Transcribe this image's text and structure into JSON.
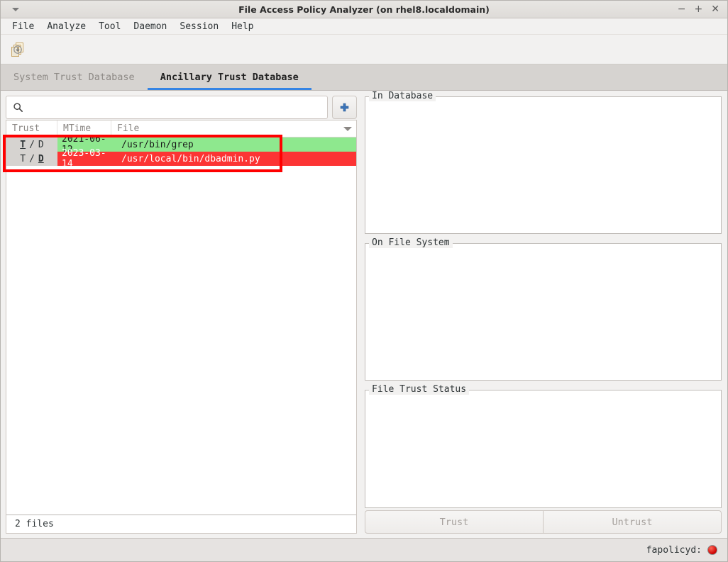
{
  "window": {
    "title": "File Access Policy Analyzer (on rhel8.localdomain)",
    "menu_icon": "window-menu-triangle-icon",
    "minimize_label": "−",
    "maximize_label": "+",
    "close_label": "✕"
  },
  "menubar": {
    "items": [
      {
        "label": "File"
      },
      {
        "label": "Analyze"
      },
      {
        "label": "Tool"
      },
      {
        "label": "Daemon"
      },
      {
        "label": "Session"
      },
      {
        "label": "Help"
      }
    ]
  },
  "toolbar": {
    "deploy_icon": "deploy-changes-icon"
  },
  "tabs": [
    {
      "label": "System Trust Database",
      "active": false
    },
    {
      "label": "Ancillary Trust Database",
      "active": true
    }
  ],
  "search": {
    "icon": "search-icon",
    "value": "",
    "placeholder": "",
    "add_button_icon": "plus-icon"
  },
  "list": {
    "columns": [
      {
        "label": "Trust"
      },
      {
        "label": "MTime"
      },
      {
        "label": "File"
      }
    ],
    "column_menu_icon": "chevron-down-icon",
    "rows": [
      {
        "trust_t": "T",
        "trust_sep": "/",
        "trust_d": "D",
        "selected_flag": "T",
        "mtime": "2021-06-12",
        "file": "/usr/bin/grep",
        "state": "trusted"
      },
      {
        "trust_t": "T",
        "trust_sep": "/",
        "trust_d": "D",
        "selected_flag": "D",
        "mtime": "2023-03-14",
        "file": "/usr/local/bin/dbadmin.py",
        "state": "untrusted"
      }
    ],
    "status": "2 files"
  },
  "panels": {
    "in_database": {
      "legend": "In Database",
      "content": ""
    },
    "on_file_system": {
      "legend": "On File System",
      "content": ""
    },
    "file_trust_status": {
      "legend": "File Trust Status",
      "content": ""
    }
  },
  "actions": {
    "trust_label": "Trust",
    "untrust_label": "Untrust"
  },
  "statusbar": {
    "daemon_label": "fapolicyd:",
    "daemon_state_icon": "status-dot-red",
    "daemon_state_color": "#cc0000"
  },
  "colors": {
    "accent": "#3584e4",
    "trusted_row": "#8ee88e",
    "untrusted_row": "#fc3434",
    "annotation": "#ff0000"
  }
}
